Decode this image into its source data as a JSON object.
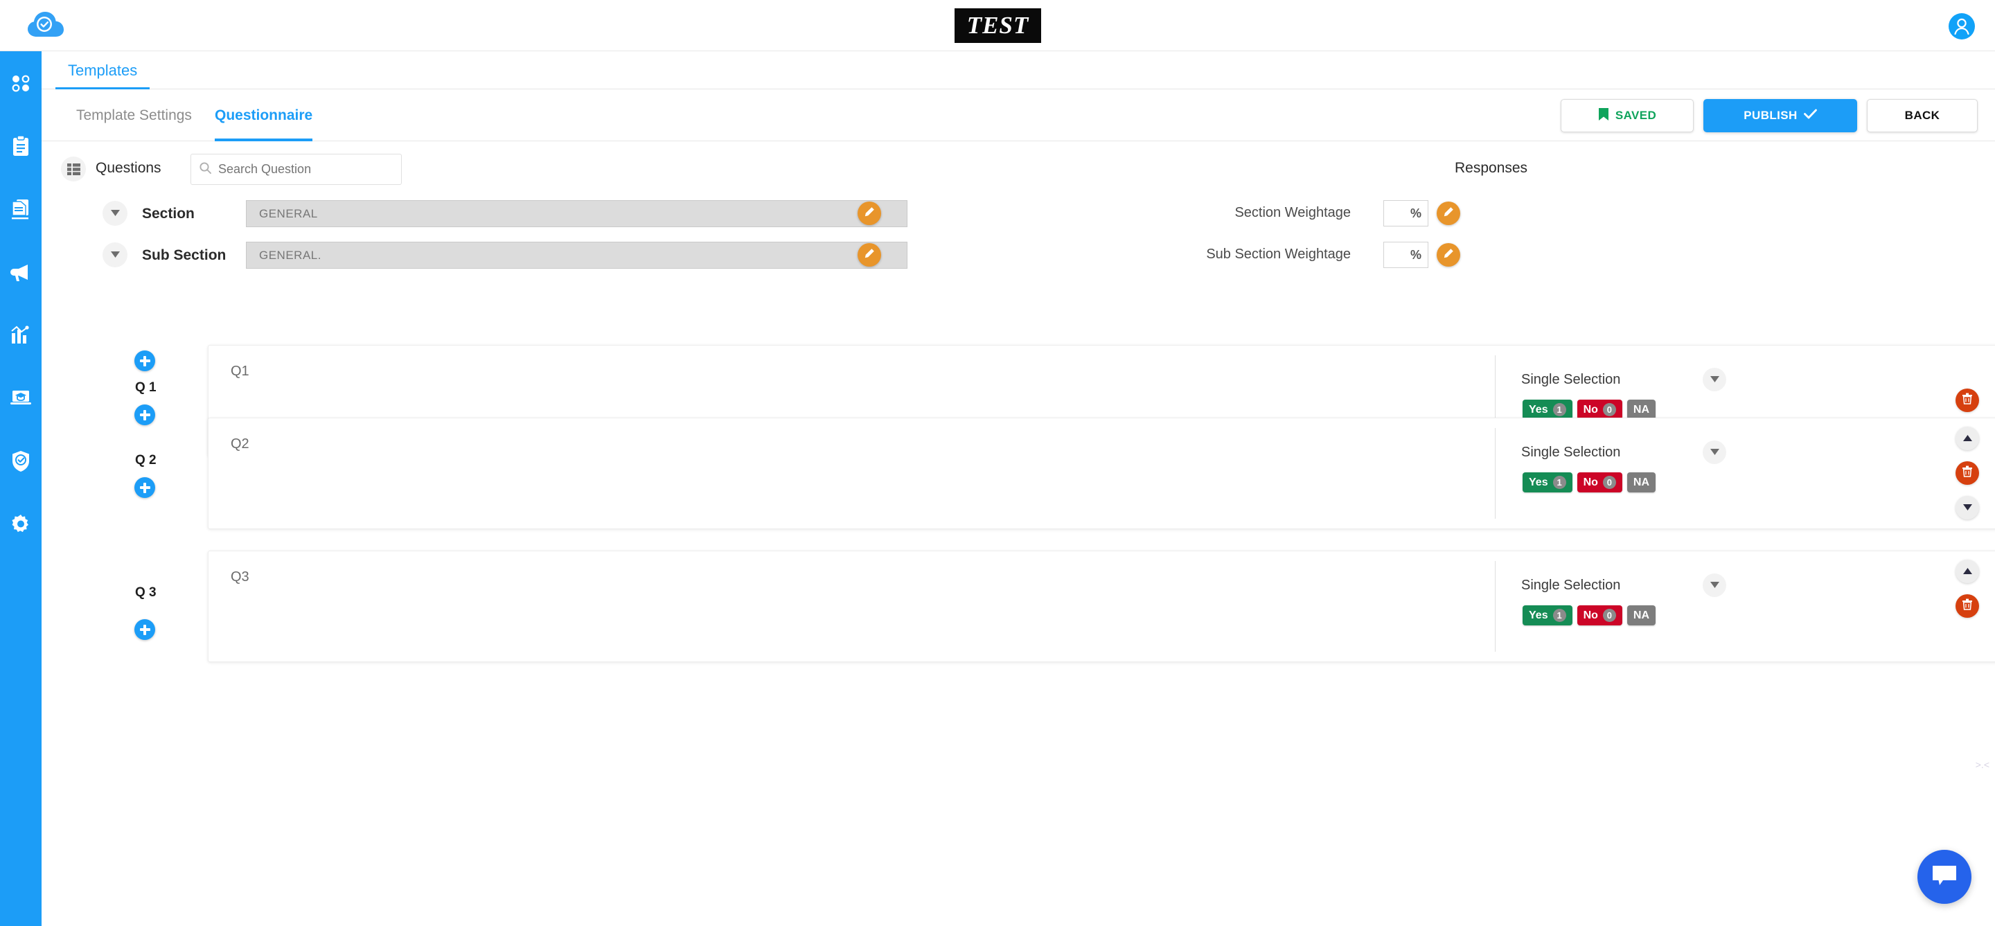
{
  "header": {
    "logo_icon": "cloud-check-icon",
    "brand_badge": "TEST",
    "avatar_icon": "user-avatar-icon"
  },
  "sidebar": {
    "items": [
      {
        "icon": "dashboard-dots-icon",
        "name": "dashboard"
      },
      {
        "icon": "clipboard-icon",
        "name": "tasks"
      },
      {
        "icon": "documents-icon",
        "name": "documents"
      },
      {
        "icon": "megaphone-icon",
        "name": "announcements"
      },
      {
        "icon": "bar-chart-icon",
        "name": "reports"
      },
      {
        "icon": "graduation-laptop-icon",
        "name": "training"
      },
      {
        "icon": "shield-check-icon",
        "name": "compliance"
      },
      {
        "icon": "gear-icon",
        "name": "settings"
      }
    ]
  },
  "tabs": {
    "primary": "Templates",
    "secondary": [
      {
        "label": "Template Settings",
        "active": false
      },
      {
        "label": "Questionnaire",
        "active": true
      }
    ]
  },
  "toolbar": {
    "saved_label": "SAVED",
    "publish_label": "PUBLISH",
    "back_label": "BACK",
    "saved_color": "#0fa45c",
    "publish_color": "#1c9df7"
  },
  "questions_panel": {
    "title": "Questions",
    "list_icon": "list-icon",
    "search_placeholder": "Search Question",
    "search_value": "",
    "search_icon": "search-icon",
    "responses_title": "Responses"
  },
  "section": {
    "label": "Section",
    "value": "GENERAL",
    "weightage_label": "Section Weightage",
    "weightage_value": "",
    "weightage_unit": "%",
    "edit_icon": "pencil-icon"
  },
  "sub_section": {
    "label": "Sub Section",
    "value": "GENERAL.",
    "weightage_label": "Sub Section Weightage",
    "weightage_value": "",
    "weightage_unit": "%",
    "edit_icon": "pencil-icon"
  },
  "questions": [
    {
      "number": "Q 1",
      "text": "Q1",
      "selection_type": "Single Selection",
      "responses": [
        {
          "label": "Yes",
          "count": "1",
          "color": "#158c55"
        },
        {
          "label": "No",
          "count": "0",
          "color": "#cc0527"
        },
        {
          "label": "NA",
          "count": "",
          "color": "#7d7d7d"
        }
      ],
      "has_move_up": false,
      "has_move_down": true,
      "has_delete": true
    },
    {
      "number": "Q 2",
      "text": "Q2",
      "selection_type": "Single Selection",
      "responses": [
        {
          "label": "Yes",
          "count": "1",
          "color": "#158c55"
        },
        {
          "label": "No",
          "count": "0",
          "color": "#cc0527"
        },
        {
          "label": "NA",
          "count": "",
          "color": "#7d7d7d"
        }
      ],
      "has_move_up": true,
      "has_move_down": true,
      "has_delete": true
    },
    {
      "number": "Q 3",
      "text": "Q3",
      "selection_type": "Single Selection",
      "responses": [
        {
          "label": "Yes",
          "count": "1",
          "color": "#158c55"
        },
        {
          "label": "No",
          "count": "0",
          "color": "#cc0527"
        },
        {
          "label": "NA",
          "count": "",
          "color": "#7d7d7d"
        }
      ],
      "has_move_up": true,
      "has_move_down": false,
      "has_delete": true
    }
  ],
  "chat": {
    "icon": "chat-bubble-icon",
    "color": "#2563eb"
  },
  "corner_mark": ">.<"
}
